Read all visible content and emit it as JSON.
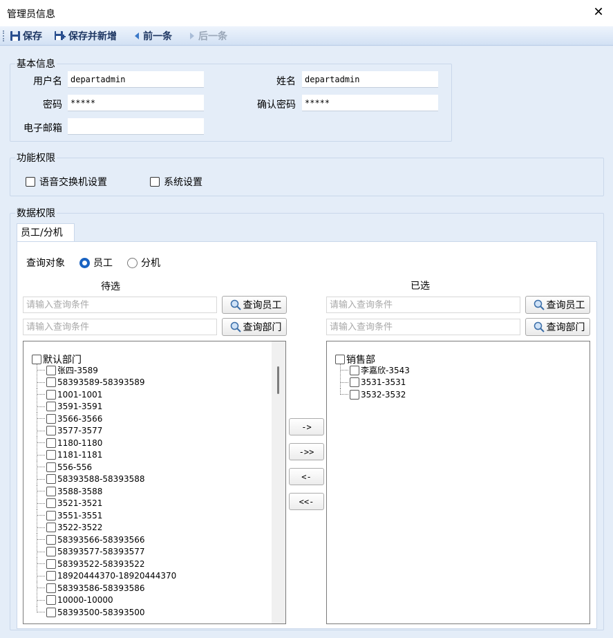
{
  "window": {
    "title": "管理员信息"
  },
  "toolbar": {
    "save": "保存",
    "save_new": "保存并新增",
    "prev": "前一条",
    "next": "后一条"
  },
  "basic": {
    "title": "基本信息",
    "username_label": "用户名",
    "username": "departadmin",
    "name_label": "姓名",
    "name": "departadmin",
    "password_label": "密码",
    "password": "*****",
    "confirm_label": "确认密码",
    "confirm": "*****",
    "email_label": "电子邮箱",
    "email": ""
  },
  "functions": {
    "title": "功能权限",
    "items": [
      "语音交换机设置",
      "系统设置"
    ]
  },
  "data_perm": {
    "title": "数据权限",
    "tab": "员工/分机",
    "query_label": "查询对象",
    "radio_employee": "员工",
    "radio_extension": "分机",
    "pending_header": "待选",
    "selected_header": "已选",
    "placeholder": "请输入查询条件",
    "btn_query_employee": "查询员工",
    "btn_query_dept": "查询部门"
  },
  "pending_tree": {
    "root": "默认部门",
    "items": [
      "张四-3589",
      "58393589-58393589",
      "1001-1001",
      "3591-3591",
      "3566-3566",
      "3577-3577",
      "1180-1180",
      "1181-1181",
      "556-556",
      "58393588-58393588",
      "3588-3588",
      "3521-3521",
      "3551-3551",
      "3522-3522",
      "58393566-58393566",
      "58393577-58393577",
      "58393522-58393522",
      "18920444370-18920444370",
      "58393586-58393586",
      "10000-10000",
      "58393500-58393500"
    ]
  },
  "selected_tree": {
    "root": "销售部",
    "items": [
      "李嘉欣-3543",
      "3531-3531",
      "3532-3532"
    ]
  },
  "move_buttons": {
    "add": "->",
    "add_all": "->>",
    "remove": "<-",
    "remove_all": "<<-"
  },
  "colors": {
    "accent": "#1a63c2",
    "toolbar_text": "#1e3763",
    "panel_bg": "#e4edf8"
  }
}
